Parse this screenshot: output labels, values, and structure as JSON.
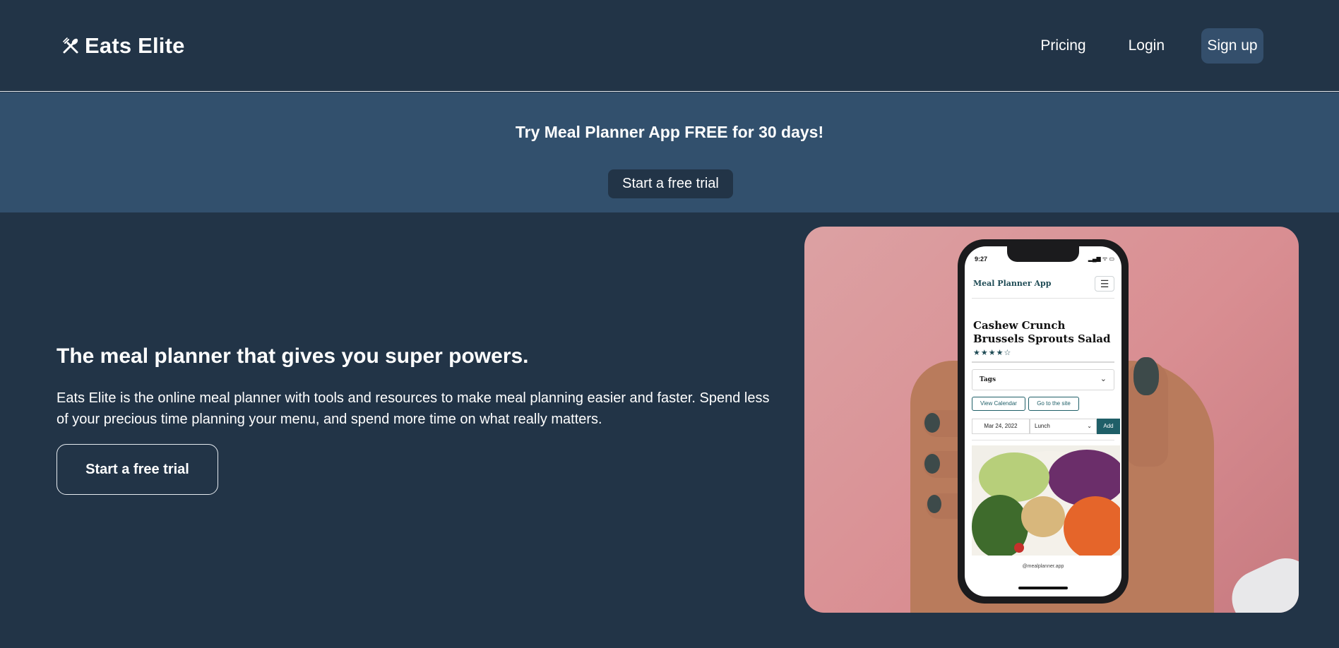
{
  "header": {
    "brand": "Eats Elite",
    "nav": {
      "pricing": "Pricing",
      "login": "Login",
      "signup": "Sign up"
    }
  },
  "banner": {
    "title": "Try Meal Planner App FREE for 30 days!",
    "cta": "Start a free trial"
  },
  "hero": {
    "title": "The meal planner that gives you super powers.",
    "description": "Eats Elite is the online meal planner with tools and resources to make meal planning easier and faster. Spend less of your precious time planning your menu, and spend more time on what really matters.",
    "cta": "Start a free trial"
  },
  "phone_screen": {
    "status_time": "9:27",
    "status_icons": "▂▄▆ ᯤ ▭",
    "app_title": "Meal Planner App",
    "recipe_title": "Cashew Crunch Brussels Sprouts Salad",
    "rating_stars": "★★★★☆",
    "tags_label": "Tags",
    "view_calendar": "View Calendar",
    "go_to_site": "Go to the site",
    "date": "Mar 24, 2022",
    "meal": "Lunch",
    "add": "Add",
    "footer_url": "@mealplanner.app"
  },
  "colors": {
    "page_bg": "#223447",
    "banner_bg": "#32506d",
    "signup_bg": "#344f6c",
    "photo_bg": "#d98e92",
    "app_accent": "#1f5f68"
  },
  "icons": {
    "logo": "fork-spoon-icon",
    "menu": "hamburger-icon",
    "tags_chevron": "chevron-down-icon",
    "select_chevron": "chevron-down-icon"
  }
}
